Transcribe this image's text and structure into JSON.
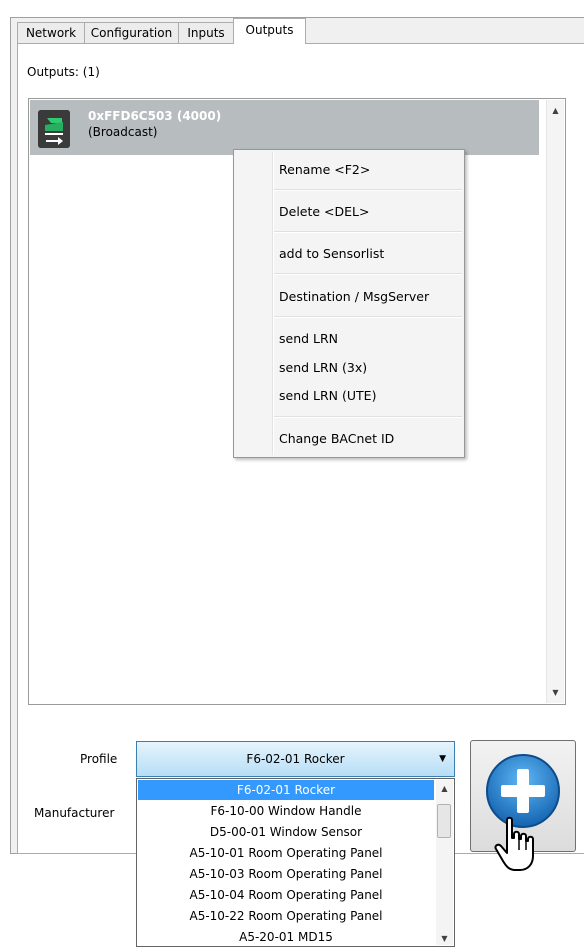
{
  "tabs": [
    "Network",
    "Configuration",
    "Inputs",
    "Outputs"
  ],
  "active_tab": "Outputs",
  "outputs_label": "Outputs: (1)",
  "list": {
    "selected_item": {
      "id": "0xFFD6C503 (4000)",
      "subtitle": "(Broadcast)"
    }
  },
  "context_menu": {
    "rename": "Rename <F2>",
    "delete": "Delete <DEL>",
    "add_sensorlist": "add to Sensorlist",
    "destination": "Destination / MsgServer",
    "send_lrn": "send LRN",
    "send_lrn_3x": "send LRN (3x)",
    "send_lrn_ute": "send LRN (UTE)",
    "change_bacnet": "Change BACnet ID"
  },
  "form": {
    "profile_label": "Profile",
    "profile_value": "F6-02-01 Rocker",
    "manufacturer_label": "Manufacturer"
  },
  "dropdown_items": [
    "F6-02-01 Rocker",
    "F6-10-00 Window Handle",
    "D5-00-01 Window Sensor",
    "A5-10-01 Room Operating Panel",
    "A5-10-03 Room Operating Panel",
    "A5-10-04 Room Operating Panel",
    "A5-10-22 Room Operating Panel",
    "A5-20-01 MD15"
  ],
  "colors": {
    "accent": "#3399ff",
    "add_button_blue": "#1f78c8",
    "selection_gray": "#b7bcbf"
  },
  "icons": {
    "item": "output-device-icon",
    "add": "plus-circle-icon",
    "cursor": "hand-cursor-icon"
  }
}
